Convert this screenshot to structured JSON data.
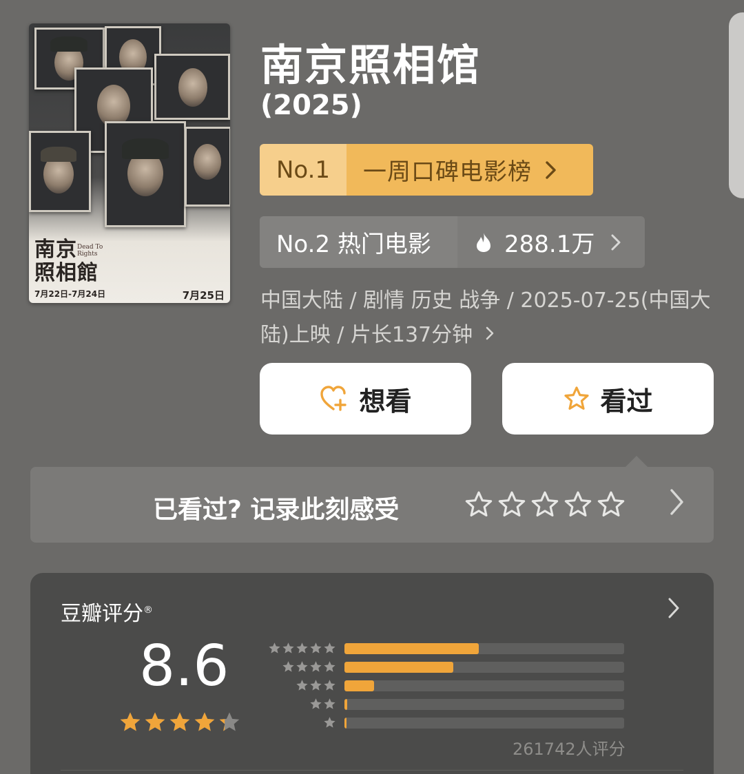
{
  "movie": {
    "title": "南京照相馆",
    "year": "(2025)",
    "meta": "中国大陆 / 剧情 历史 战争 / 2025-07-25(中国大陆)上映 / 片长137分钟"
  },
  "poster": {
    "title_line1": "南京",
    "title_line2": "照相館",
    "subtitle": "Dead To Rights",
    "dates": "7月22日-7月24日",
    "release": "7月25日"
  },
  "rank_primary": {
    "rank": "No.1",
    "list_name": "一周口碑电影榜"
  },
  "rank_secondary": {
    "rank": "No.2 热门电影",
    "heat": "288.1万"
  },
  "actions": {
    "want_label": "想看",
    "seen_label": "看过"
  },
  "record": {
    "prompt": "已看过? 记录此刻感受"
  },
  "rating": {
    "label": "豆瓣评分",
    "mark": "®",
    "score": "8.6",
    "score_fraction": 0.86,
    "count": "261742人评分",
    "distribution": [
      {
        "stars": 5,
        "share": 0.48
      },
      {
        "stars": 4,
        "share": 0.39
      },
      {
        "stars": 3,
        "share": 0.105
      },
      {
        "stars": 2,
        "share": 0.01
      },
      {
        "stars": 1,
        "share": 0.006
      }
    ]
  },
  "icons": {
    "chevron": "chevron-right-icon",
    "flame": "flame-icon",
    "heart_plus": "heart-plus-icon",
    "star": "star-icon"
  },
  "colors": {
    "background": "#6b6a68",
    "rank_gold": "#f1b95a",
    "accent_orange": "#f0a53a",
    "card": "#4b4b4a"
  }
}
